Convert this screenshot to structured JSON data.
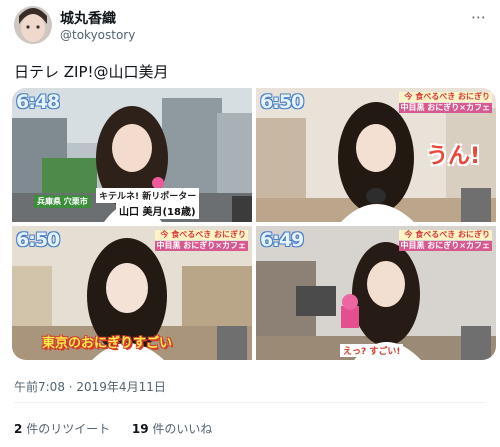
{
  "author": {
    "display_name": "城丸香織",
    "handle": "@tokyostory"
  },
  "tweet": {
    "text": "日テレ ZIP!@山口美月",
    "timestamp": "午前7:08 · 2019年4月11日"
  },
  "media": [
    {
      "clock": "6:48",
      "caption_top": "キテルネ! 新リポーター",
      "caption_name": "山口 美月(18歳)",
      "location": "兵庫県 穴栗市"
    },
    {
      "clock": "6:50",
      "corner_top": "今 食べるべき おにぎり",
      "corner_bottom": "中目黒 おにぎり×カフェ",
      "exclamation": "うん!"
    },
    {
      "clock": "6:50",
      "corner_top": "今 食べるべき おにぎり",
      "corner_bottom": "中目黒 おにぎり×カフェ",
      "subtitle": "東京のおにぎりすごい"
    },
    {
      "clock": "6:49",
      "corner_top": "今 食べるべき おにぎり",
      "corner_bottom": "中目黒 おにぎり×カフェ",
      "subtitle": "えっ? すごい!"
    }
  ],
  "engagement": {
    "retweet_count": "2",
    "retweet_label": "件のリツイート",
    "like_count": "19",
    "like_label": "件のいいね"
  },
  "icons": {
    "more": "more-icon"
  }
}
